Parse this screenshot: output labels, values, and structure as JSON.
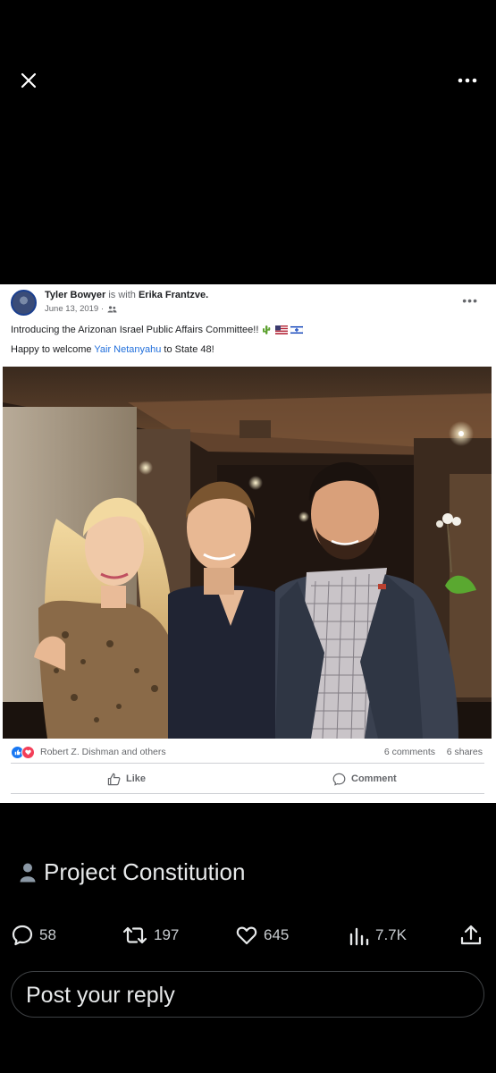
{
  "viewer": {
    "close_icon": "close-icon",
    "more_icon": "more-horizontal-icon"
  },
  "post_card": {
    "author": "Tyler Bowyer",
    "with_text": "is with",
    "tagged": "Erika Frantzve.",
    "date": "June 13, 2019 ·",
    "audience_icon": "friends-icon",
    "line1": "Introducing the Arizonan Israel Public Affairs Committee!!",
    "line1_emojis": [
      "cactus",
      "us-flag",
      "israel-flag"
    ],
    "line2_prefix": "Happy to welcome ",
    "line2_link": "Yair Netanyahu",
    "line2_suffix": " to State 48!",
    "reactors": "Robert Z. Dishman and others",
    "comments": "6 comments",
    "shares": "6 shares",
    "like_label": "Like",
    "comment_label": "Comment",
    "colors": {
      "link": "#216fdb",
      "like_reaction": "#1877f2",
      "love_reaction": "#f33e58"
    }
  },
  "community": {
    "icon": "person-icon",
    "name": "Project Constitution"
  },
  "engagement": {
    "replies": "58",
    "reposts": "197",
    "likes": "645",
    "views": "7.7K"
  },
  "reply": {
    "placeholder": "Post your reply"
  }
}
